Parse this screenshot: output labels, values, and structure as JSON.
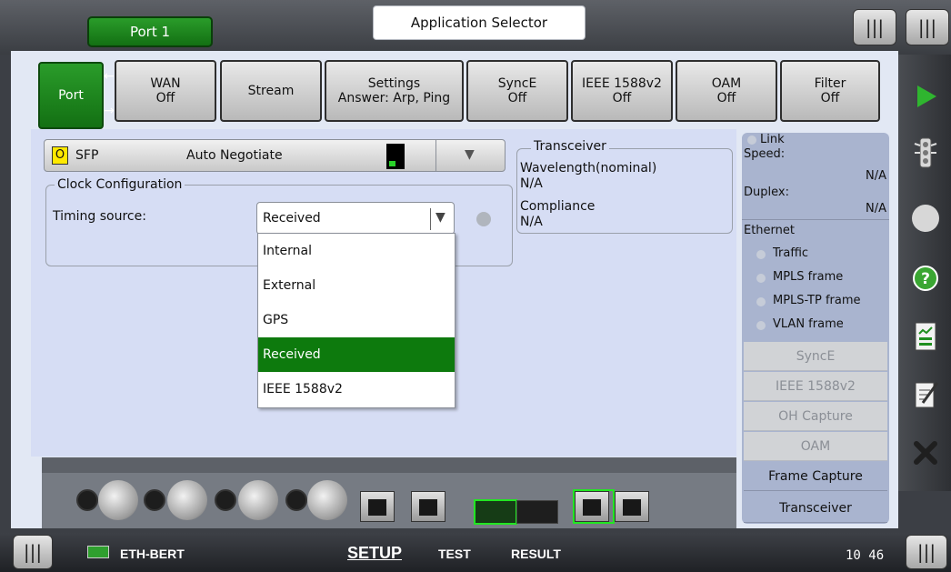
{
  "header": {
    "port_tab": "Port 1",
    "app_selector": "Application Selector"
  },
  "tabs": [
    {
      "line1": "Port",
      "line2": ""
    },
    {
      "line1": "WAN",
      "line2": "Off"
    },
    {
      "line1": "Stream",
      "line2": ""
    },
    {
      "line1": "Settings",
      "line2": "Answer: Arp, Ping"
    },
    {
      "line1": "SyncE",
      "line2": "Off"
    },
    {
      "line1": "IEEE 1588v2",
      "line2": "Off"
    },
    {
      "line1": "OAM",
      "line2": "Off"
    },
    {
      "line1": "Filter",
      "line2": "Off"
    }
  ],
  "interface": {
    "badge": "O",
    "type": "SFP",
    "mode": "Auto Negotiate"
  },
  "clock": {
    "legend": "Clock Configuration",
    "timing_label": "Timing source:",
    "timing_value": "Received",
    "options": [
      "Internal",
      "External",
      "GPS",
      "Received",
      "IEEE 1588v2"
    ],
    "selected_index": 3
  },
  "transceiver": {
    "legend": "Transceiver",
    "wavelength_label": "Wavelength(nominal)",
    "wavelength_value": "N/A",
    "compliance_label": "Compliance",
    "compliance_value": "N/A"
  },
  "status": {
    "link": "Link",
    "speed_label": "Speed:",
    "speed_value": "N/A",
    "duplex_label": "Duplex:",
    "duplex_value": "N/A",
    "ethernet_label": "Ethernet",
    "ethernet_items": [
      "Traffic",
      "MPLS frame",
      "MPLS-TP frame",
      "VLAN frame"
    ],
    "buttons": [
      "SyncE",
      "IEEE 1588v2",
      "OH Capture",
      "OAM",
      "Frame Capture",
      "Transceiver"
    ]
  },
  "bottom": {
    "app_name": "ETH-BERT",
    "nav": [
      "SETUP",
      "TEST",
      "RESULT"
    ],
    "clock": "10 46"
  },
  "colors": {
    "accent_green": "#137013",
    "selected_green": "#0d7a0d",
    "play_green": "#2fb52f",
    "help_green": "#3aa632",
    "panel_blue": "#d6ddf4"
  },
  "icons": [
    "menu-handle-icon",
    "play-icon",
    "traffic-light-icon",
    "record-icon",
    "help-icon",
    "report-icon",
    "edit-icon",
    "close-icon",
    "eth-bert-app-icon",
    "dropdown-arrow-icon"
  ]
}
